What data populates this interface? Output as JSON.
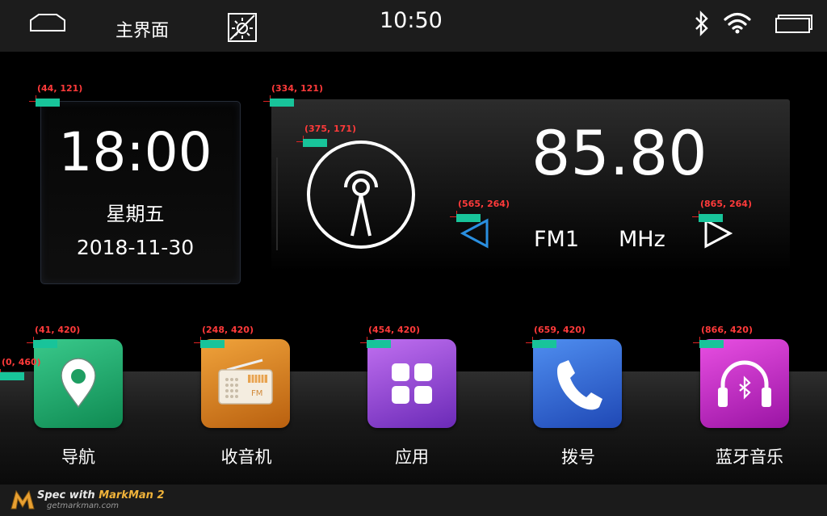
{
  "status_bar": {
    "title": "主界面",
    "time": "10:50"
  },
  "clock_widget": {
    "time": "18:00",
    "weekday": "星期五",
    "date": "2018-11-30"
  },
  "radio_widget": {
    "frequency": "85.80",
    "band": "FM1",
    "unit": "MHz"
  },
  "dock": {
    "apps": [
      {
        "label": "导航",
        "icon": "map-pin-icon",
        "color": "#1fae6d"
      },
      {
        "label": "收音机",
        "icon": "radio-icon",
        "color": "#d8852a"
      },
      {
        "label": "应用",
        "icon": "app-grid-icon",
        "color": "#9a4fd6"
      },
      {
        "label": "拨号",
        "icon": "phone-icon",
        "color": "#3a6fd9"
      },
      {
        "label": "蓝牙音乐",
        "icon": "bluetooth-headphones-icon",
        "color": "#c832c8"
      }
    ]
  },
  "markers": [
    {
      "label": "(44, 121)"
    },
    {
      "label": "(334, 121)"
    },
    {
      "label": "(375, 171)"
    },
    {
      "label": "(565, 264)"
    },
    {
      "label": "(865, 264)"
    },
    {
      "label": "(41, 420)"
    },
    {
      "label": "(248, 420)"
    },
    {
      "label": "(454, 420)"
    },
    {
      "label": "(659, 420)"
    },
    {
      "label": "(866, 420)"
    },
    {
      "label": "(0, 460)"
    }
  ],
  "footer": {
    "brand_prefix": "Spec with ",
    "brand_name": "MarkMan 2",
    "url": "getmarkman.com"
  },
  "colors": {
    "accent_blue": "#2a8fe0",
    "marker_fill": "#18c49a",
    "marker_text": "#ff3a3a"
  }
}
